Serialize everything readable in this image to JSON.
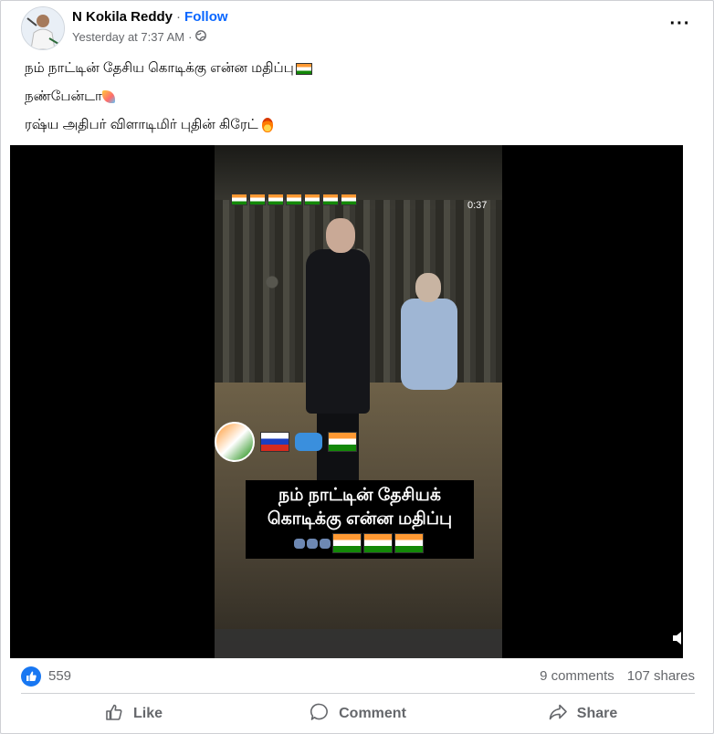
{
  "post": {
    "author": "N Kokila Reddy",
    "follow_label": "Follow",
    "timestamp": "Yesterday at 7:37 AM",
    "lines": [
      "நம் நாட்டின் தேசிய கொடிக்கு என்ன மதிப்பு",
      "நண்பேன்டா",
      "ரஷ்ய அதிபர் விளாடிமிர் புதின் கிரேட்"
    ]
  },
  "video": {
    "time": "0:37",
    "caption_line1": "நம் நாட்டின் தேசியக்",
    "caption_line2": "கொடிக்கு என்ன மதிப்பு"
  },
  "stats": {
    "likes": "559",
    "comments": "9 comments",
    "shares": "107 shares"
  },
  "actions": {
    "like": "Like",
    "comment": "Comment",
    "share": "Share"
  },
  "icons": [
    "globe-icon",
    "more-options-icon",
    "mute-icon",
    "like-reaction-icon",
    "like-icon",
    "comment-icon",
    "share-icon"
  ],
  "colors": {
    "accent": "#0866ff",
    "like_blue": "#1877f2",
    "muted_text": "#65676b"
  }
}
